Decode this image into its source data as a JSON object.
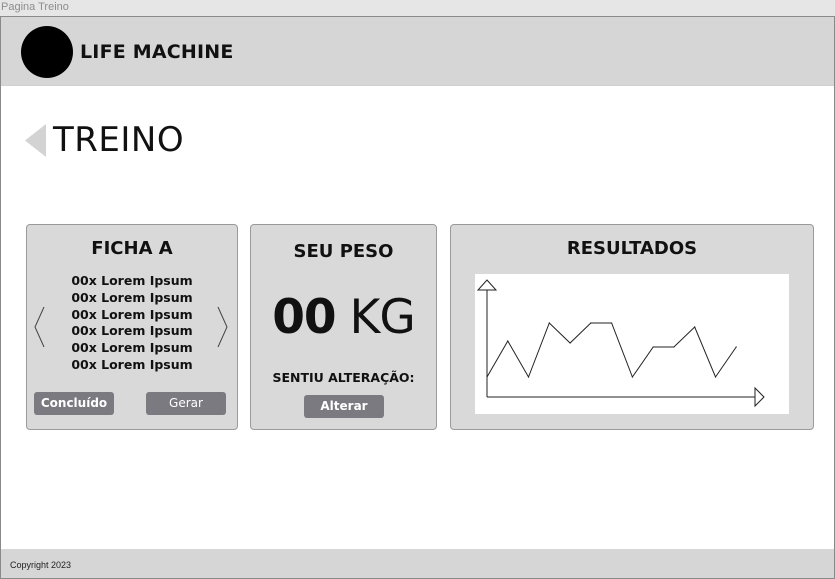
{
  "window": {
    "title": "Pagina Treino"
  },
  "header": {
    "brand": "LIFE MACHINE"
  },
  "page": {
    "title": "TREINO"
  },
  "ficha": {
    "title": "FICHA A",
    "items": [
      "00x Lorem Ipsum",
      "00x Lorem Ipsum",
      "00x Lorem Ipsum",
      "00x Lorem Ipsum",
      "00x Lorem Ipsum",
      "00x Lorem Ipsum"
    ],
    "done_label": "Concluído",
    "generate_label": "Gerar"
  },
  "peso": {
    "title": "SEU PESO",
    "value": "00",
    "unit": "KG",
    "question": "SENTIU ALTERAÇÃO:",
    "change_label": "Alterar"
  },
  "resultados": {
    "title": "RESULTADOS"
  },
  "footer": {
    "copyright": "Copyright 2023"
  },
  "icons": {
    "logo": "logo-circle-icon",
    "back": "back-triangle-icon",
    "prev": "chevron-left-icon",
    "next": "chevron-right-icon"
  },
  "colors": {
    "header_bg": "#d6d6d6",
    "card_bg": "#d9d9d9",
    "button_bg": "#7a7a80",
    "page_bg": "#ffffff"
  },
  "chart_data": {
    "type": "line",
    "title": "",
    "xlabel": "",
    "ylabel": "",
    "x": [
      0,
      1,
      2,
      3,
      4,
      5,
      6,
      7,
      8,
      9,
      10,
      11,
      12
    ],
    "values": [
      1.0,
      2.8,
      1.0,
      3.7,
      2.7,
      3.7,
      3.7,
      1.0,
      2.5,
      2.5,
      3.5,
      1.0,
      2.5
    ],
    "xlim": [
      0,
      13
    ],
    "ylim": [
      0,
      5
    ],
    "grid": false,
    "legend": "none"
  }
}
